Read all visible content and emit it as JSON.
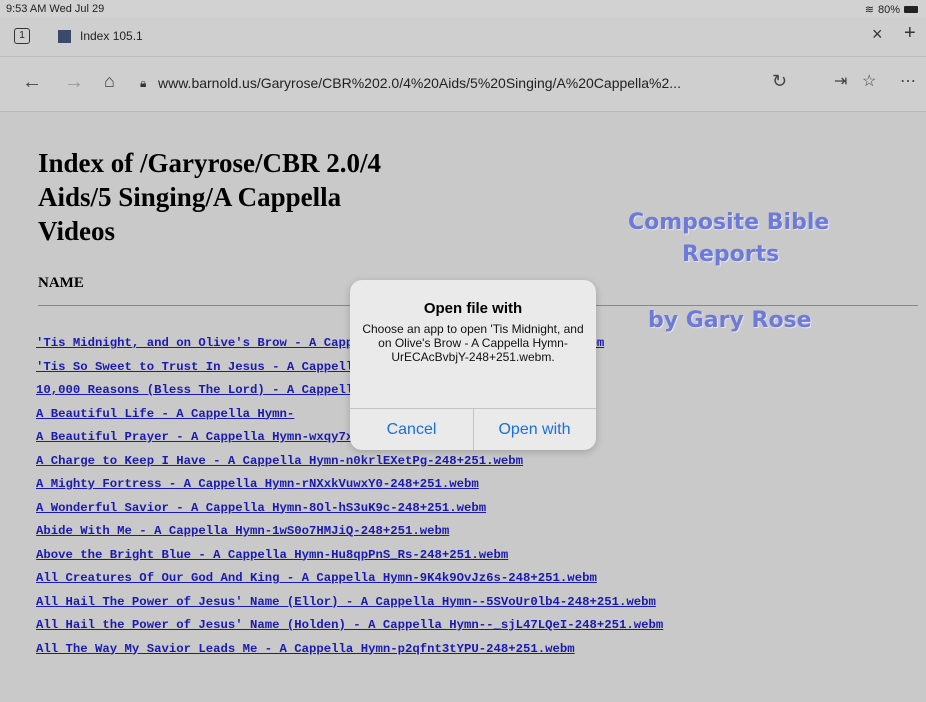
{
  "status": {
    "time": "9:53 AM  Wed Jul 29",
    "battery": "80%"
  },
  "tab": {
    "count": "1",
    "title": "Index 105.1"
  },
  "address": {
    "url": "www.barnold.us/Garyrose/CBR%202.0/4%20Aids/5%20Singing/A%20Cappella%2..."
  },
  "page": {
    "heading": "Index of /Garyrose/CBR 2.0/4 Aids/5 Singing/A Cappella Videos",
    "name_col": "NAME",
    "brand_lines": [
      "Composite Bible",
      "Reports",
      "by Gary Rose"
    ],
    "files": [
      "'Tis Midnight, and on Olive's Brow - A Cappella Hymn-UrECAcBvbjY-248+251.webm",
      "'Tis So Sweet to Trust In Jesus - A Cappella Hymn-?-248+251.webm",
      "10,000 Reasons (Bless The Lord) - A Cappella Hymn-?-248+251.webm",
      "A Beautiful Life - A Cappella Hymn-",
      "A Beautiful Prayer - A Cappella Hymn-wxqy7xn11lQ-248+251.webm",
      "A Charge to Keep I Have - A Cappella Hymn-n0krlEXetPg-248+251.webm",
      "A Mighty Fortress - A Cappella Hymn-rNXxkVuwxY0-248+251.webm",
      "A Wonderful Savior - A Cappella Hymn-8Ol-hS3uK9c-248+251.webm",
      "Abide With Me - A Cappella Hymn-1wS0o7HMJiQ-248+251.webm",
      "Above the Bright Blue - A Cappella Hymn-Hu8qpPnS_Rs-248+251.webm",
      "All Creatures Of Our God And King - A Cappella Hymn-9K4k9OvJz6s-248+251.webm",
      "All Hail The Power of Jesus' Name (Ellor) - A Cappella Hymn--5SVoUr0lb4-248+251.webm",
      "All Hail the Power of Jesus' Name (Holden) - A Cappella Hymn--_sjL47LQeI-248+251.webm",
      "All The Way My Savior Leads Me - A Cappella Hymn-p2qfnt3tYPU-248+251.webm"
    ]
  },
  "dialog": {
    "title": "Open file with",
    "message": "Choose an app to open 'Tis Midnight, and on Olive's Brow - A Cappella Hymn-UrECAcBvbjY-248+251.webm.",
    "cancel": "Cancel",
    "confirm": "Open with"
  }
}
